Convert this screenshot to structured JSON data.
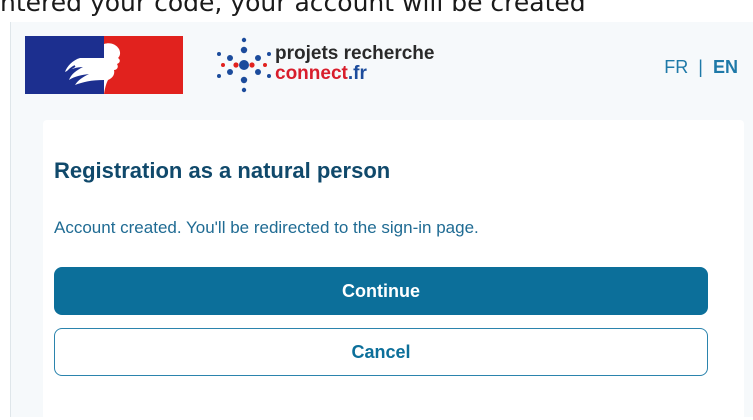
{
  "top_caption": "ntered your code, your account will be created",
  "header": {
    "brand_line1": "projets recherche",
    "brand_line2_name": "connect",
    "brand_line2_tld": ".fr",
    "lang_fr": "FR",
    "lang_separator": "|",
    "lang_en": "EN"
  },
  "card": {
    "title": "Registration as a natural person",
    "message": "Account created. You'll be redirected to the sign-in page.",
    "continue_label": "Continue",
    "cancel_label": "Cancel"
  },
  "colors": {
    "primary": "#0c6f9a",
    "title": "#10496b",
    "logo_blue": "#1c2f8f",
    "logo_red": "#e1221e"
  },
  "icons": {
    "government_logo": "marianne-logo-icon",
    "brand_mark": "network-dots-icon"
  }
}
